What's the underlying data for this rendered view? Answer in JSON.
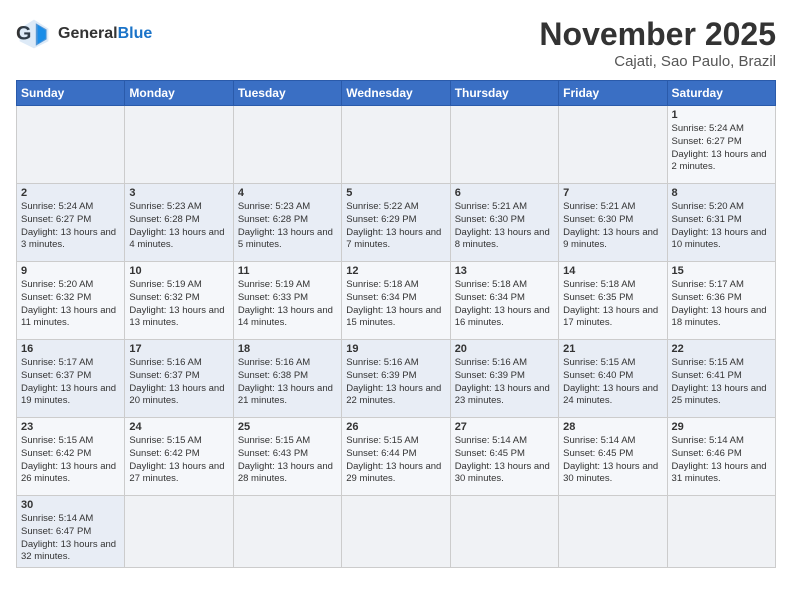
{
  "header": {
    "logo_general": "General",
    "logo_blue": "Blue",
    "month_title": "November 2025",
    "location": "Cajati, Sao Paulo, Brazil"
  },
  "days_of_week": [
    "Sunday",
    "Monday",
    "Tuesday",
    "Wednesday",
    "Thursday",
    "Friday",
    "Saturday"
  ],
  "weeks": [
    [
      {
        "day": "",
        "info": ""
      },
      {
        "day": "",
        "info": ""
      },
      {
        "day": "",
        "info": ""
      },
      {
        "day": "",
        "info": ""
      },
      {
        "day": "",
        "info": ""
      },
      {
        "day": "",
        "info": ""
      },
      {
        "day": "1",
        "info": "Sunrise: 5:24 AM\nSunset: 6:27 PM\nDaylight: 13 hours and 2 minutes."
      }
    ],
    [
      {
        "day": "2",
        "info": "Sunrise: 5:24 AM\nSunset: 6:27 PM\nDaylight: 13 hours and 3 minutes."
      },
      {
        "day": "3",
        "info": "Sunrise: 5:23 AM\nSunset: 6:28 PM\nDaylight: 13 hours and 4 minutes."
      },
      {
        "day": "4",
        "info": "Sunrise: 5:23 AM\nSunset: 6:28 PM\nDaylight: 13 hours and 5 minutes."
      },
      {
        "day": "5",
        "info": "Sunrise: 5:22 AM\nSunset: 6:29 PM\nDaylight: 13 hours and 7 minutes."
      },
      {
        "day": "6",
        "info": "Sunrise: 5:21 AM\nSunset: 6:30 PM\nDaylight: 13 hours and 8 minutes."
      },
      {
        "day": "7",
        "info": "Sunrise: 5:21 AM\nSunset: 6:30 PM\nDaylight: 13 hours and 9 minutes."
      },
      {
        "day": "8",
        "info": "Sunrise: 5:20 AM\nSunset: 6:31 PM\nDaylight: 13 hours and 10 minutes."
      }
    ],
    [
      {
        "day": "9",
        "info": "Sunrise: 5:20 AM\nSunset: 6:32 PM\nDaylight: 13 hours and 11 minutes."
      },
      {
        "day": "10",
        "info": "Sunrise: 5:19 AM\nSunset: 6:32 PM\nDaylight: 13 hours and 13 minutes."
      },
      {
        "day": "11",
        "info": "Sunrise: 5:19 AM\nSunset: 6:33 PM\nDaylight: 13 hours and 14 minutes."
      },
      {
        "day": "12",
        "info": "Sunrise: 5:18 AM\nSunset: 6:34 PM\nDaylight: 13 hours and 15 minutes."
      },
      {
        "day": "13",
        "info": "Sunrise: 5:18 AM\nSunset: 6:34 PM\nDaylight: 13 hours and 16 minutes."
      },
      {
        "day": "14",
        "info": "Sunrise: 5:18 AM\nSunset: 6:35 PM\nDaylight: 13 hours and 17 minutes."
      },
      {
        "day": "15",
        "info": "Sunrise: 5:17 AM\nSunset: 6:36 PM\nDaylight: 13 hours and 18 minutes."
      }
    ],
    [
      {
        "day": "16",
        "info": "Sunrise: 5:17 AM\nSunset: 6:37 PM\nDaylight: 13 hours and 19 minutes."
      },
      {
        "day": "17",
        "info": "Sunrise: 5:16 AM\nSunset: 6:37 PM\nDaylight: 13 hours and 20 minutes."
      },
      {
        "day": "18",
        "info": "Sunrise: 5:16 AM\nSunset: 6:38 PM\nDaylight: 13 hours and 21 minutes."
      },
      {
        "day": "19",
        "info": "Sunrise: 5:16 AM\nSunset: 6:39 PM\nDaylight: 13 hours and 22 minutes."
      },
      {
        "day": "20",
        "info": "Sunrise: 5:16 AM\nSunset: 6:39 PM\nDaylight: 13 hours and 23 minutes."
      },
      {
        "day": "21",
        "info": "Sunrise: 5:15 AM\nSunset: 6:40 PM\nDaylight: 13 hours and 24 minutes."
      },
      {
        "day": "22",
        "info": "Sunrise: 5:15 AM\nSunset: 6:41 PM\nDaylight: 13 hours and 25 minutes."
      }
    ],
    [
      {
        "day": "23",
        "info": "Sunrise: 5:15 AM\nSunset: 6:42 PM\nDaylight: 13 hours and 26 minutes."
      },
      {
        "day": "24",
        "info": "Sunrise: 5:15 AM\nSunset: 6:42 PM\nDaylight: 13 hours and 27 minutes."
      },
      {
        "day": "25",
        "info": "Sunrise: 5:15 AM\nSunset: 6:43 PM\nDaylight: 13 hours and 28 minutes."
      },
      {
        "day": "26",
        "info": "Sunrise: 5:15 AM\nSunset: 6:44 PM\nDaylight: 13 hours and 29 minutes."
      },
      {
        "day": "27",
        "info": "Sunrise: 5:14 AM\nSunset: 6:45 PM\nDaylight: 13 hours and 30 minutes."
      },
      {
        "day": "28",
        "info": "Sunrise: 5:14 AM\nSunset: 6:45 PM\nDaylight: 13 hours and 30 minutes."
      },
      {
        "day": "29",
        "info": "Sunrise: 5:14 AM\nSunset: 6:46 PM\nDaylight: 13 hours and 31 minutes."
      }
    ],
    [
      {
        "day": "30",
        "info": "Sunrise: 5:14 AM\nSunset: 6:47 PM\nDaylight: 13 hours and 32 minutes."
      },
      {
        "day": "",
        "info": ""
      },
      {
        "day": "",
        "info": ""
      },
      {
        "day": "",
        "info": ""
      },
      {
        "day": "",
        "info": ""
      },
      {
        "day": "",
        "info": ""
      },
      {
        "day": "",
        "info": ""
      }
    ]
  ]
}
